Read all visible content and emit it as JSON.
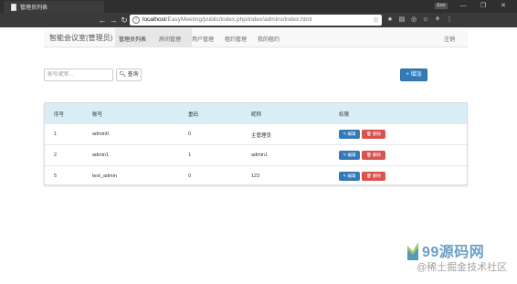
{
  "browser": {
    "tab_title": "管理员列表",
    "user_badge": "Eoo",
    "url_host": "localhost",
    "url_path": "/EasyMeeting/public/index.php/index/admins/index.html",
    "nav": {
      "back": "←",
      "forward": "→",
      "reload": "↻",
      "home": "⌂"
    },
    "window": {
      "minimize": "—",
      "maximize": "❐",
      "close": "✕"
    }
  },
  "navbar": {
    "brand": "智能会议室(管理员)",
    "items": [
      {
        "label": "管理员列表",
        "active": true
      },
      {
        "label": "房间管理"
      },
      {
        "label": "用户管理"
      },
      {
        "label": "租约管理"
      },
      {
        "label": "我的租约"
      }
    ],
    "logout": "注销"
  },
  "search": {
    "placeholder": "账号/昵称...",
    "button_label": "查询",
    "add_label": "增加"
  },
  "table": {
    "headers": [
      "序号",
      "账号",
      "重码",
      "昵称",
      "权限"
    ],
    "rows": [
      {
        "id": "1",
        "account": "admin0",
        "recode": "0",
        "nickname": "主管理员"
      },
      {
        "id": "2",
        "account": "admin1",
        "recode": "1",
        "nickname": "admin1"
      },
      {
        "id": "5",
        "account": "test_admin",
        "recode": "0",
        "nickname": "123"
      }
    ],
    "edit_label": "编辑",
    "delete_label": "删除"
  },
  "watermark": {
    "title": "99源码网",
    "subtitle": "@稀土掘金技术社区"
  },
  "colors": {
    "primary": "#337ab7",
    "danger": "#d9534f",
    "table_header": "#d9edf7"
  }
}
